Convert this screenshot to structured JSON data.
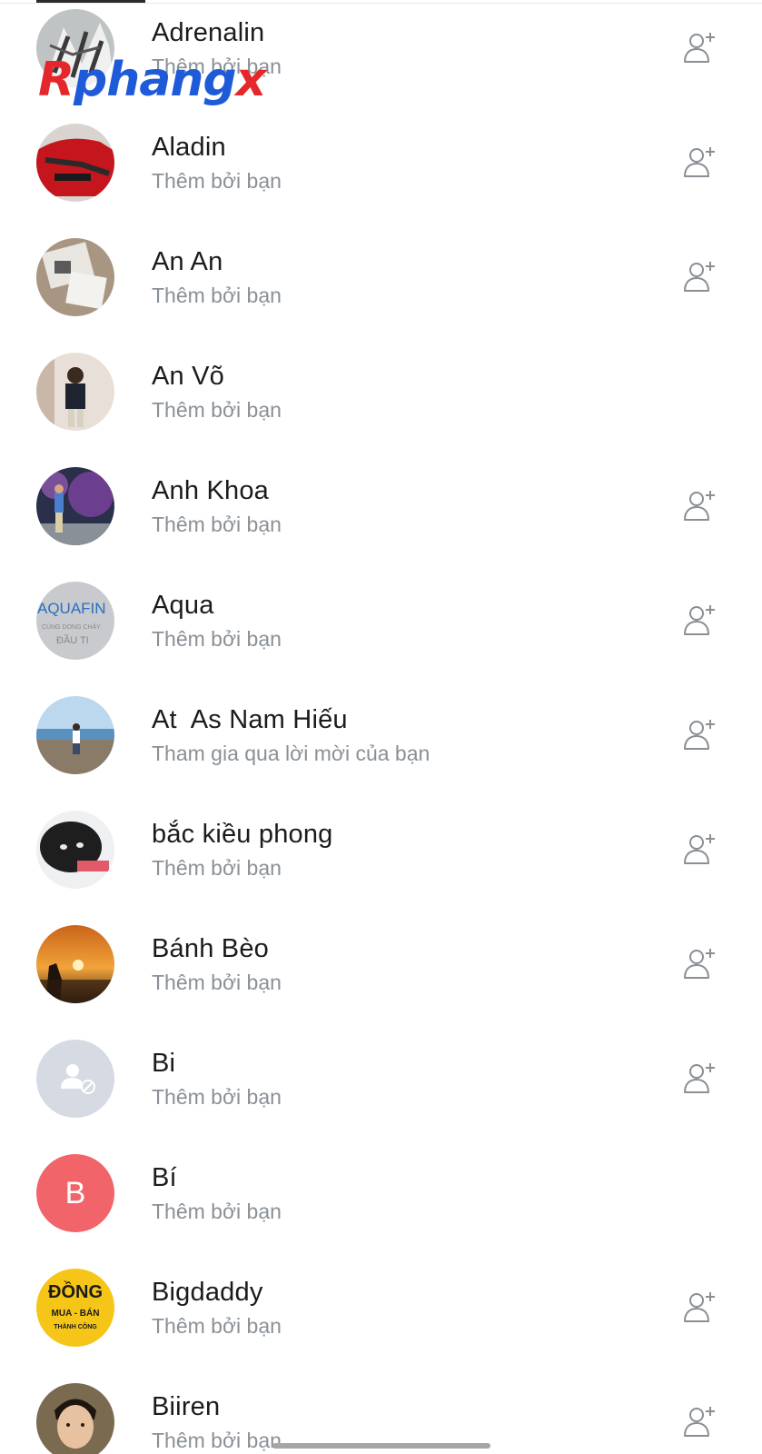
{
  "watermark": {
    "part1": "R",
    "part2": "phang",
    "part3": "x"
  },
  "contacts": [
    {
      "name": "Adrenalin",
      "subtitle": "Thêm bởi bạn",
      "has_add_friend": true
    },
    {
      "name": "Aladin",
      "subtitle": "Thêm bởi bạn",
      "has_add_friend": true
    },
    {
      "name": "An An",
      "subtitle": "Thêm bởi bạn",
      "has_add_friend": true
    },
    {
      "name": "An Võ",
      "subtitle": "Thêm bởi bạn",
      "has_add_friend": false
    },
    {
      "name": "Anh Khoa",
      "subtitle": "Thêm bởi bạn",
      "has_add_friend": true
    },
    {
      "name": "Aqua",
      "subtitle": "Thêm bởi bạn",
      "has_add_friend": true
    },
    {
      "name": "At  As Nam Hiếu",
      "subtitle": "Tham gia qua lời mời của bạn",
      "has_add_friend": true
    },
    {
      "name": "bắc kiều phong",
      "subtitle": "Thêm bởi bạn",
      "has_add_friend": true
    },
    {
      "name": "Bánh Bèo",
      "subtitle": "Thêm bởi bạn",
      "has_add_friend": true
    },
    {
      "name": "Bi",
      "subtitle": "Thêm bởi bạn",
      "has_add_friend": true
    },
    {
      "name": "Bí",
      "subtitle": "Thêm bởi bạn",
      "has_add_friend": false,
      "avatar_letter": "B",
      "avatar_color": "#f1646a"
    },
    {
      "name": "Bigdaddy",
      "subtitle": "Thêm bởi bạn",
      "has_add_friend": true,
      "avatar_text_1": "ĐỒNG",
      "avatar_text_2": "MUA - BÁN",
      "avatar_text_3": "THÀNH CÔNG"
    },
    {
      "name": "Biiren",
      "subtitle": "Thêm bởi bạn",
      "has_add_friend": true
    }
  ],
  "avatar_text": {
    "aqua_1": "AQUAFIN",
    "aqua_2": "CÙNG DONG CHẢY",
    "aqua_3": "ĐẦU TI"
  },
  "colors": {
    "name": "#1b1b1b",
    "subtitle": "#8a9096",
    "icon": "#8a8f95"
  }
}
